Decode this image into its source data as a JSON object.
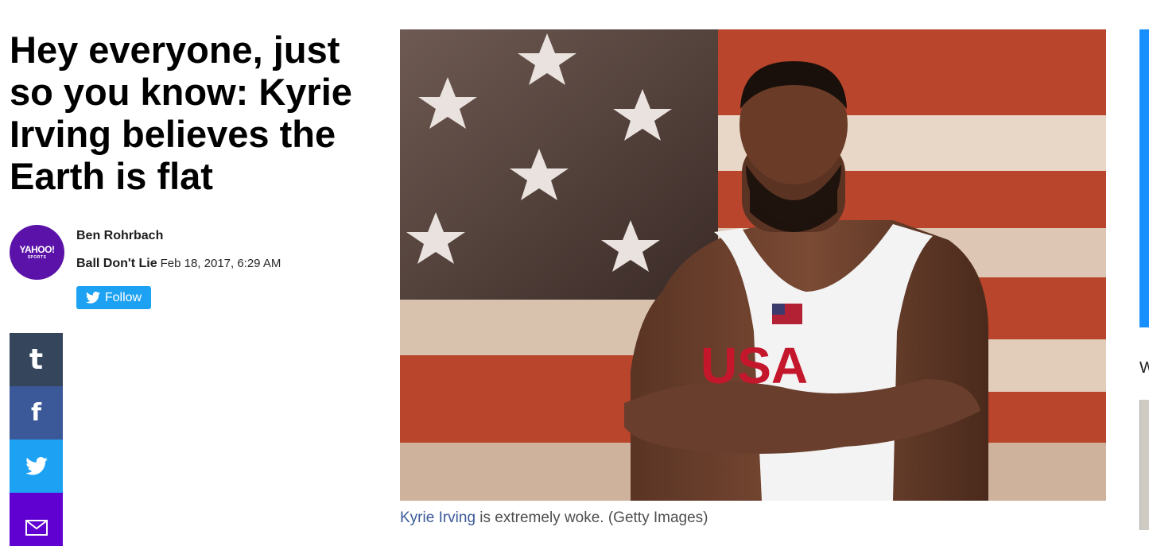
{
  "article": {
    "headline": "Hey everyone, just so you know: Kyrie Irving believes the Earth is flat"
  },
  "author": {
    "name": "Ben Rohrbach",
    "provider": "Ball Don't Lie",
    "date": "Feb 18, 2017, 6:29 AM",
    "avatar_logo": "YAHOO!",
    "avatar_sub": "SPORTS",
    "follow_label": "Follow"
  },
  "share": [
    {
      "name": "tumblr",
      "icon": "tumblr-icon",
      "glyph": "t",
      "color": "#35465c"
    },
    {
      "name": "facebook",
      "icon": "facebook-icon",
      "glyph": "f",
      "color": "#3b5998"
    },
    {
      "name": "twitter",
      "icon": "twitter-icon",
      "color": "#1da1f2"
    },
    {
      "name": "mail",
      "icon": "mail-icon",
      "color": "#6001d2"
    }
  ],
  "hero": {
    "caption_link": "Kyrie Irving",
    "caption_text": " is extremely woke. (Getty Images)",
    "jersey_text": "USA"
  },
  "right_rail": {
    "letter": "W"
  },
  "colors": {
    "twitter_blue": "#1da1f2",
    "yahoo_purple": "#6001d2",
    "link_blue": "#3b5998"
  }
}
